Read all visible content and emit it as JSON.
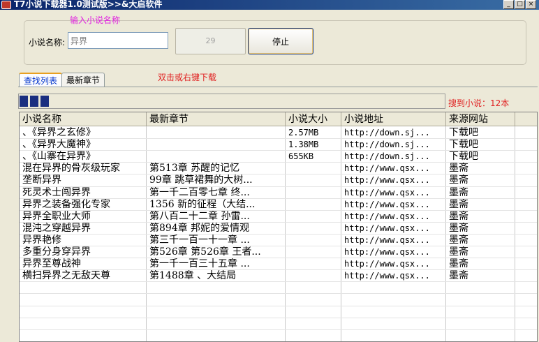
{
  "window": {
    "title": "T7小说下载器1.0测试版>>&大启软件",
    "controls": [
      "_",
      "□",
      "×"
    ]
  },
  "search": {
    "group_caption": "输入小说名称",
    "label": "小说名称:",
    "value": "异界",
    "count": "29",
    "stop_label": "停止"
  },
  "tabs": [
    {
      "label": "查找列表",
      "active": true
    },
    {
      "label": "最新章节",
      "active": false
    }
  ],
  "hint": "双击或右键下载",
  "progress": {
    "fraction": 0.07
  },
  "found_text": "搜到小说：12本",
  "table": {
    "columns": [
      "小说名称",
      "最新章节",
      "小说大小",
      "小说地址",
      "来源网站"
    ],
    "rows": [
      [
        "、《异界之玄修》",
        "",
        "2.57MB",
        "http://down.sj...",
        "下载吧"
      ],
      [
        "、《异界大魔神》",
        "",
        "1.38MB",
        "http://down.sj...",
        "下载吧"
      ],
      [
        "、《山寨在异界》",
        "",
        "655KB",
        "http://down.sj...",
        "下载吧"
      ],
      [
        "混在异界的骨灰级玩家",
        "第513章 苏醒的记忆",
        "",
        "http://www.qsx...",
        "墨斋"
      ],
      [
        "垄断异界",
        "99章 跳草裙舞的大树...",
        "",
        "http://www.qsx...",
        "墨斋"
      ],
      [
        "死灵术士闯异界",
        "第一千二百零七章 终...",
        "",
        "http://www.qsx...",
        "墨斋"
      ],
      [
        "异界之装备强化专家",
        "1356 新的征程（大结...",
        "",
        "http://www.qsx...",
        "墨斋"
      ],
      [
        "异界全职业大师",
        "第八百二十二章 孙雷...",
        "",
        "http://www.qsx...",
        "墨斋"
      ],
      [
        "混沌之穿越异界",
        "第894章 邦妮的爱情观",
        "",
        "http://www.qsx...",
        "墨斋"
      ],
      [
        "异界艳修",
        "第三千一百一十一章 ...",
        "",
        "http://www.qsx...",
        "墨斋"
      ],
      [
        "多重分身穿异界",
        "第526章 第526章 王者...",
        "",
        "http://www.qsx...",
        "墨斋"
      ],
      [
        "异界至尊战神",
        "第一千一百三十五章 ...",
        "",
        "http://www.qsx...",
        "墨斋"
      ],
      [
        "横扫异界之无敌天尊",
        "第1488章 、大结局",
        "",
        "http://www.qsx...",
        "墨斋"
      ]
    ]
  }
}
